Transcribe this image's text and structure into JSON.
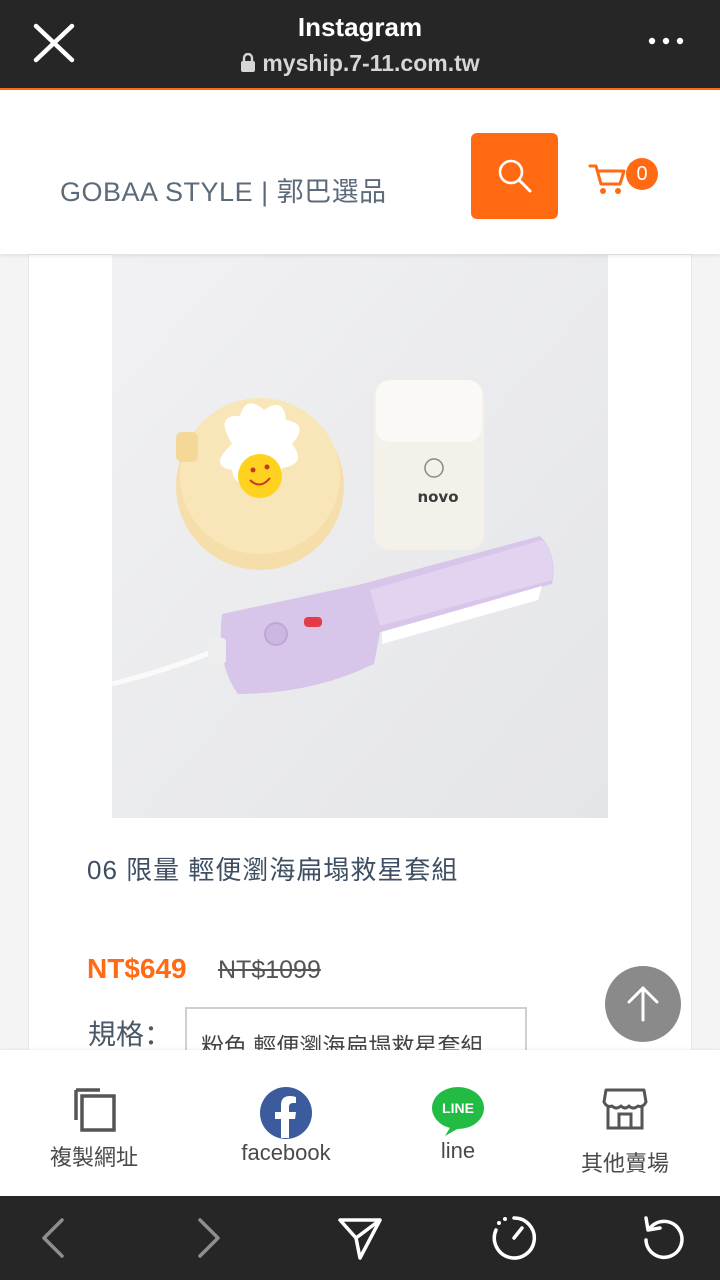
{
  "browser": {
    "title": "Instagram",
    "url": "myship.7-11.com.tw",
    "icons": [
      "close-icon",
      "lock-icon",
      "more-icon"
    ]
  },
  "header": {
    "brand": "GOBAA STYLE | 郭巴選品",
    "cart_count": "0",
    "accent_color": "#ff6a13"
  },
  "product": {
    "title": "06 限量 輕便瀏海扁塌救星套組",
    "price": "NT$649",
    "original_price": "NT$1099",
    "spec_label": "規格：",
    "spec_value": "粉色 輕便瀏海扁塌救星套組",
    "image_text": "novo"
  },
  "share": {
    "items": [
      {
        "label": "複製網址",
        "icon": "copy-icon"
      },
      {
        "label": "facebook",
        "icon": "facebook-icon"
      },
      {
        "label": "line",
        "icon": "line-icon",
        "badge": "LINE"
      },
      {
        "label": "其他賣場",
        "icon": "store-icon"
      }
    ]
  },
  "bottom_nav": [
    "back-icon",
    "forward-icon",
    "send-icon",
    "timer-icon",
    "reload-icon"
  ]
}
